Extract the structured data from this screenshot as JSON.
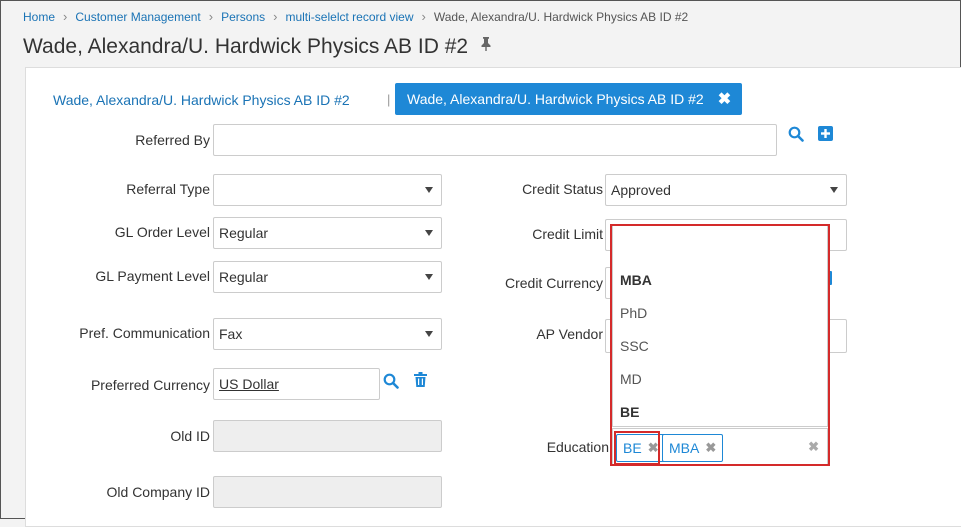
{
  "breadcrumb": {
    "items": [
      "Home",
      "Customer Management",
      "Persons",
      "multi-selelct record view"
    ],
    "current": "Wade, Alexandra/U. Hardwick Physics AB ID #2"
  },
  "page": {
    "title": "Wade, Alexandra/U. Hardwick Physics AB ID #2"
  },
  "tabs": {
    "link_label": "Wade, Alexandra/U. Hardwick Physics AB ID #2",
    "separator": "|",
    "active_label": "Wade, Alexandra/U. Hardwick Physics AB ID #2"
  },
  "form": {
    "referred_by": {
      "label": "Referred By",
      "value": ""
    },
    "referral_type": {
      "label": "Referral Type",
      "value": ""
    },
    "gl_order_level": {
      "label": "GL Order Level",
      "value": "Regular"
    },
    "gl_payment_level": {
      "label": "GL Payment Level",
      "value": "Regular"
    },
    "pref_communication": {
      "label": "Pref. Communication",
      "value": "Fax"
    },
    "preferred_currency": {
      "label": "Preferred Currency",
      "value": "US Dollar"
    },
    "old_id": {
      "label": "Old ID",
      "value": ""
    },
    "old_company_id": {
      "label": "Old Company ID",
      "value": ""
    },
    "credit_status": {
      "label": "Credit Status",
      "value": "Approved"
    },
    "credit_limit": {
      "label": "Credit Limit",
      "value": ""
    },
    "credit_currency": {
      "label": "Credit Currency",
      "value": ""
    },
    "ap_vendor": {
      "label": "AP Vendor",
      "value": ""
    },
    "education": {
      "label": "Education",
      "options": [
        "MBA",
        "PhD",
        "SSC",
        "MD",
        "BE"
      ],
      "selected": [
        "BE",
        "MBA"
      ]
    }
  },
  "icons": {
    "search": "search-icon",
    "add": "plus-square-icon",
    "delete": "trash-icon",
    "pin": "pin-icon",
    "close": "close-icon"
  },
  "colors": {
    "accent": "#1e88d6",
    "link": "#1a73b5",
    "highlight": "#d42a2a"
  }
}
